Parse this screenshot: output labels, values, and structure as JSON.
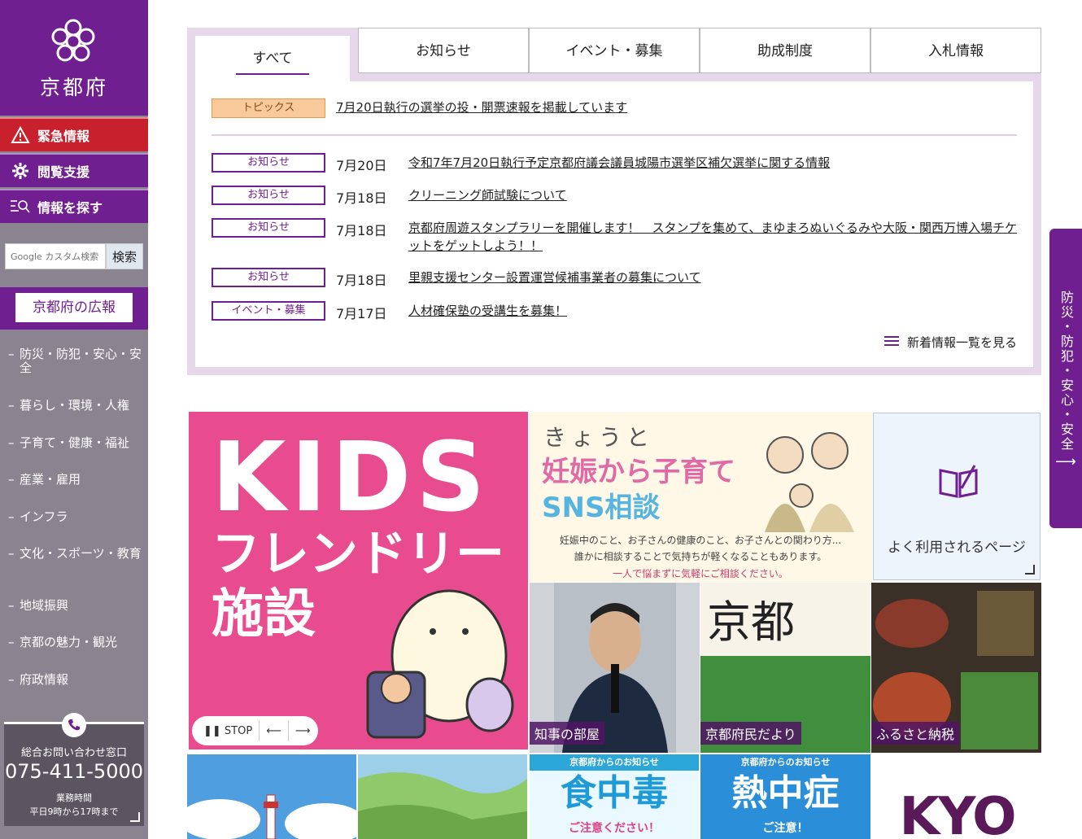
{
  "sidebar": {
    "logo_text": "京都府",
    "emergency_label": "緊急情報",
    "access_label": "閲覧支援",
    "search_label": "情報を探す",
    "search_placeholder": "Google カスタム検索",
    "search_button": "検索",
    "koho_label": "京都府の広報",
    "nav_items": [
      {
        "label": "防災・防犯・安心・安全"
      },
      {
        "label": "暮らし・環境・人権"
      },
      {
        "label": "子育て・健康・福祉"
      },
      {
        "label": "産業・雇用"
      },
      {
        "label": "インフラ"
      },
      {
        "label": "文化・スポーツ・教育"
      },
      {
        "label": "地域振興"
      },
      {
        "label": "京都の魅力・観光"
      },
      {
        "label": "府政情報"
      }
    ],
    "contact": {
      "title": "総合お問い合わせ窓口",
      "tel": "075-411-5000",
      "hours_label": "業務時間",
      "hours": "平日9時から17時まで"
    }
  },
  "news": {
    "tabs": [
      "すべて",
      "お知らせ",
      "イベント・募集",
      "助成制度",
      "入札情報"
    ],
    "topic": {
      "badge": "トピックス",
      "text": "7月20日執行の選挙の投・開票速報を掲載しています"
    },
    "items": [
      {
        "badge": "お知らせ",
        "date": "7月20日",
        "title": "令和7年7月20日執行予定京都府議会議員城陽市選挙区補欠選挙に関する情報"
      },
      {
        "badge": "お知らせ",
        "date": "7月18日",
        "title": "クリーニング師試験について"
      },
      {
        "badge": "お知らせ",
        "date": "7月18日",
        "title": "京都府周遊スタンプラリーを開催します！　スタンプを集めて、まゆまろぬいぐるみや大阪・関西万博入場チケットをゲットしよう！！"
      },
      {
        "badge": "お知らせ",
        "date": "7月18日",
        "title": "里親支援センター設置運営候補事業者の募集について"
      },
      {
        "badge": "イベント・募集",
        "date": "7月17日",
        "title": "人材確保塾の受講生を募集！"
      }
    ],
    "more_label": "新着情報一覧を見る"
  },
  "banners": {
    "kids": {
      "line1": "KIDS",
      "line2": "フレンドリー",
      "line3": "施設",
      "stop_label": "STOP"
    },
    "sns": {
      "line1": "きょうと",
      "line2": "妊娠から子育て",
      "line3": "SNS相談",
      "desc1": "妊娠中のこと、お子さんの健康のこと、お子さんとの関わり方...",
      "desc2": "誰かに相談することで気持ちが軽くなることもあります。",
      "desc3": "一人で悩まずに気軽にご相談ください。"
    },
    "often_label": "よく利用されるページ",
    "chiji": "知事の部屋",
    "dayori": "京都府民だより",
    "dayori_title": "京都",
    "furusato": "ふるさと納税",
    "food": {
      "head": "京都府からのお知らせ",
      "big": "食中毒",
      "sub": "ご注意ください！"
    },
    "heat": {
      "head": "京都府からのお知らせ",
      "big": "熱中症",
      "sub": "ご注意！"
    },
    "kyo": "KYO"
  },
  "side_tab": {
    "label": "防災・防犯・安心・安全",
    "arrow": "⟶"
  },
  "colors": {
    "brand": "#6f1f8f",
    "emergency": "#c8202d",
    "sidebar_bg": "#8a8490"
  }
}
